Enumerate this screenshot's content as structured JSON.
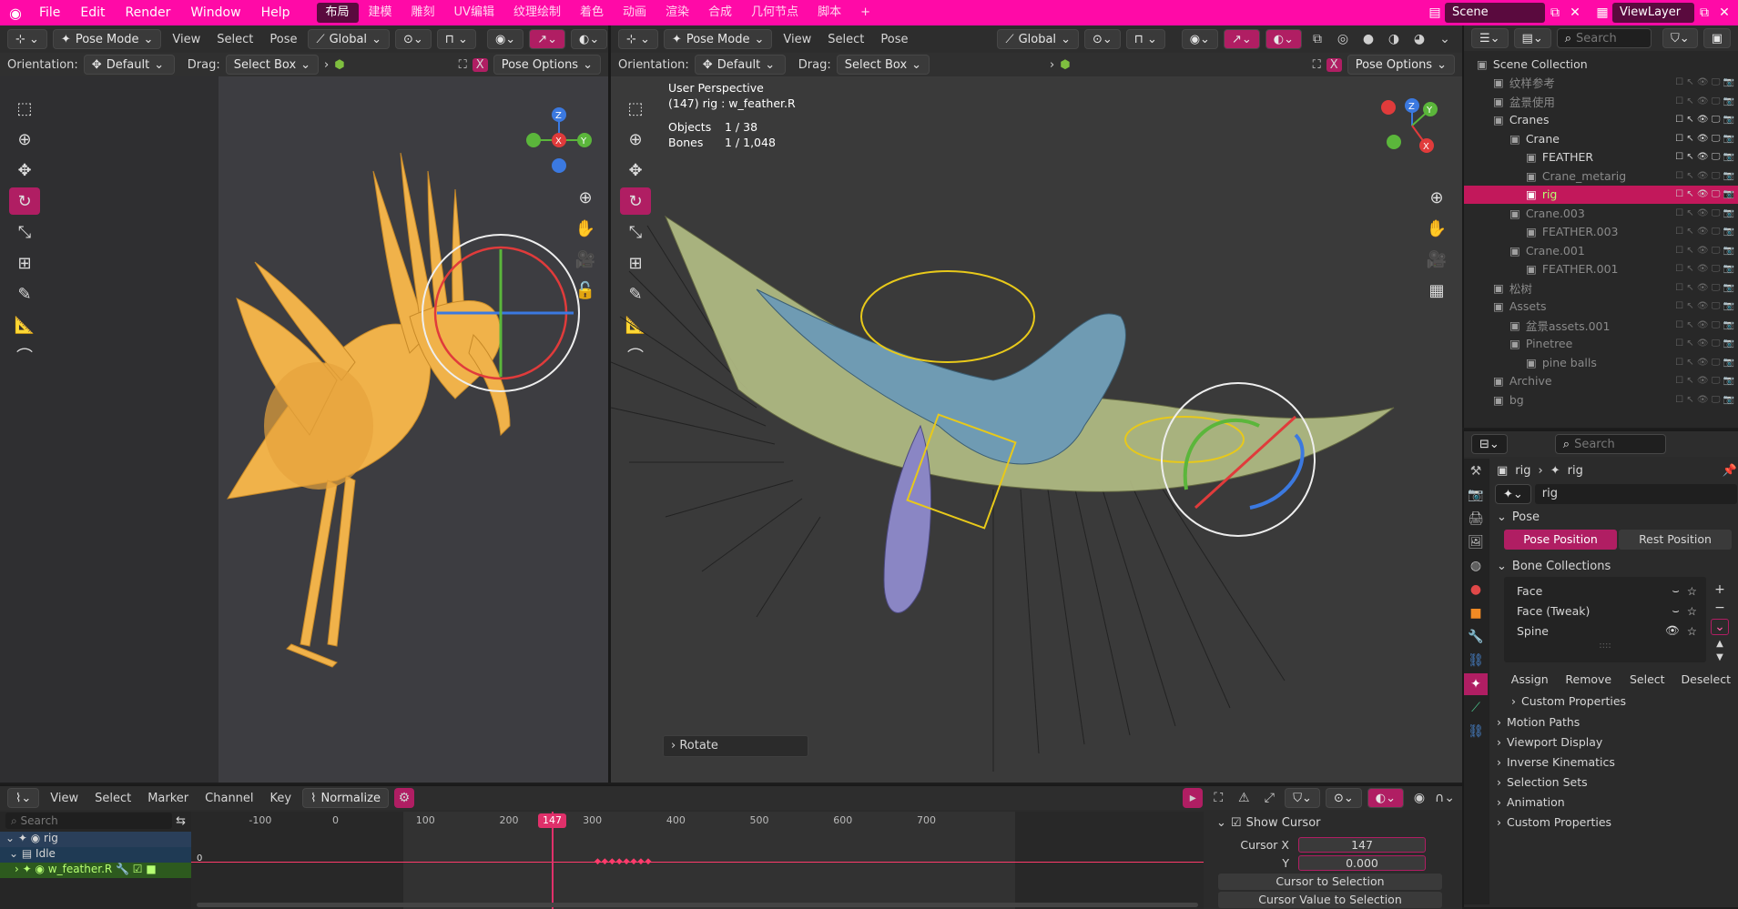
{
  "top_menu": [
    "File",
    "Edit",
    "Render",
    "Window",
    "Help"
  ],
  "workspaces": [
    "布局",
    "建模",
    "雕刻",
    "UV编辑",
    "纹理绘制",
    "着色",
    "动画",
    "渲染",
    "合成",
    "几何节点",
    "脚本"
  ],
  "scene_name": "Scene",
  "view_layer": "ViewLayer",
  "left_vp": {
    "mode": "Pose Mode",
    "menus": [
      "View",
      "Select",
      "Pose"
    ],
    "transform": "Global",
    "orientation_label": "Orientation:",
    "orientation": "Default",
    "drag_label": "Drag:",
    "drag": "Select Box",
    "pose_options": "Pose Options"
  },
  "right_vp": {
    "mode": "Pose Mode",
    "menus": [
      "View",
      "Select",
      "Pose"
    ],
    "transform": "Global",
    "orientation_label": "Orientation:",
    "orientation": "Default",
    "drag_label": "Drag:",
    "drag": "Select Box",
    "pose_options": "Pose Options",
    "persp": "User Perspective",
    "frame_info": "(147) rig : w_feather.R",
    "objects_label": "Objects",
    "objects_val": "1 / 38",
    "bones_label": "Bones",
    "bones_val": "1 / 1,048",
    "operator": "Rotate"
  },
  "outliner": {
    "search": "Search",
    "rows": [
      {
        "label": "Scene Collection",
        "indent": 0
      },
      {
        "label": "纹样参考",
        "indent": 1,
        "dim": true
      },
      {
        "label": "盆景使用",
        "indent": 1,
        "dim": true
      },
      {
        "label": "Cranes",
        "indent": 1
      },
      {
        "label": "Crane",
        "indent": 2
      },
      {
        "label": "FEATHER",
        "indent": 3
      },
      {
        "label": "Crane_metarig",
        "indent": 3,
        "dim": true
      },
      {
        "label": "rig",
        "indent": 3,
        "sel": true
      },
      {
        "label": "Crane.003",
        "indent": 2,
        "dim": true
      },
      {
        "label": "FEATHER.003",
        "indent": 3,
        "dim": true
      },
      {
        "label": "Crane.001",
        "indent": 2,
        "dim": true
      },
      {
        "label": "FEATHER.001",
        "indent": 3,
        "dim": true
      },
      {
        "label": "松树",
        "indent": 1,
        "dim": true
      },
      {
        "label": "Assets",
        "indent": 1,
        "dim": true
      },
      {
        "label": "盆景assets.001",
        "indent": 2,
        "dim": true
      },
      {
        "label": "Pinetree",
        "indent": 2,
        "dim": true
      },
      {
        "label": "pine balls",
        "indent": 3,
        "dim": true
      },
      {
        "label": "Archive",
        "indent": 1,
        "dim": true
      },
      {
        "label": "bg",
        "indent": 1,
        "dim": true
      }
    ]
  },
  "properties": {
    "search": "Search",
    "crumb_a": "rig",
    "crumb_b": "rig",
    "name_field": "rig",
    "pose_header": "Pose",
    "pose_position": "Pose Position",
    "rest_position": "Rest Position",
    "bone_collections_header": "Bone Collections",
    "collections": [
      "Face",
      "Face (Tweak)",
      "Spine"
    ],
    "actions": [
      "Assign",
      "Remove",
      "Select",
      "Deselect"
    ],
    "custom_props_sub": "Custom Properties",
    "panels": [
      "Motion Paths",
      "Viewport Display",
      "Inverse Kinematics",
      "Selection Sets",
      "Animation",
      "Custom Properties"
    ]
  },
  "timeline": {
    "menus": [
      "View",
      "Select",
      "Marker",
      "Channel",
      "Key"
    ],
    "normalize": "Normalize",
    "search": "Search",
    "ticks": [
      "-100",
      "0",
      "100",
      "147",
      "200",
      "300",
      "400",
      "500",
      "600",
      "700"
    ],
    "channels": [
      "rig",
      "Idle",
      "w_feather.R"
    ],
    "key_value": "0"
  },
  "cursor_panel": {
    "header": "Show Cursor",
    "cursor_x_label": "Cursor X",
    "cursor_x": "147",
    "y_label": "Y",
    "y": "0.000",
    "to_selection": "Cursor to Selection",
    "value_to_selection": "Cursor Value to Selection"
  }
}
